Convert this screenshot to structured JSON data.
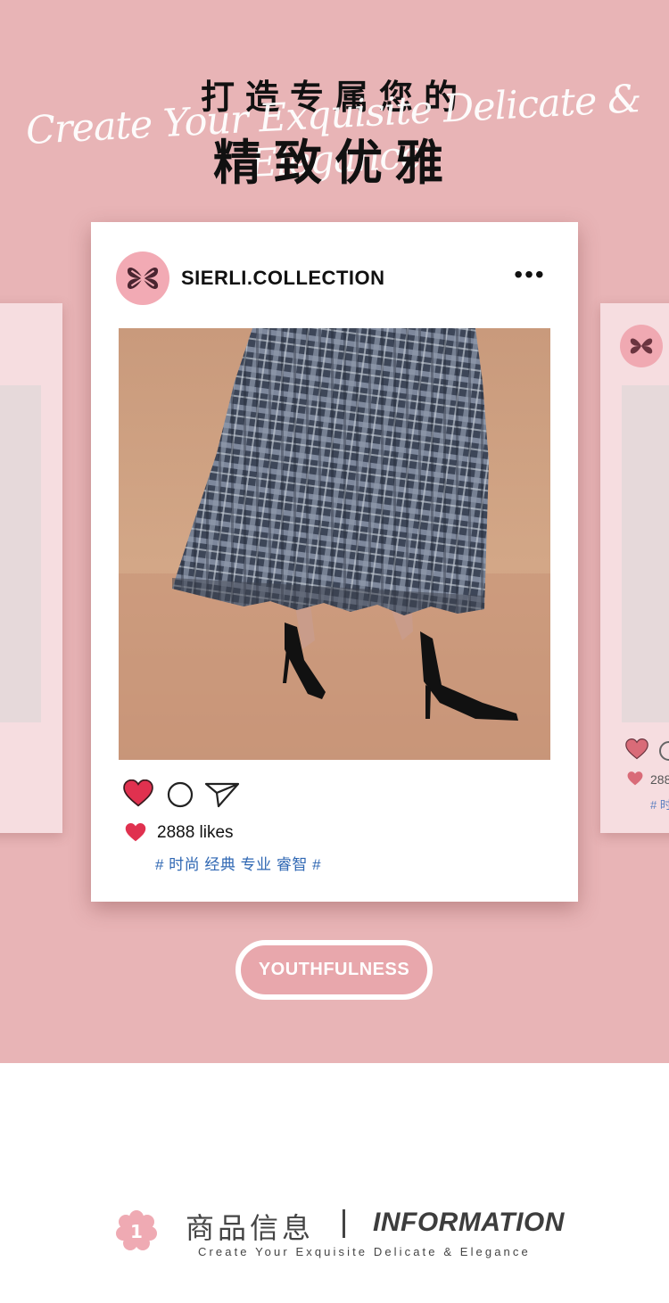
{
  "hero": {
    "headline_top": "打造专属您的",
    "script_line": "Create Your Exquisite Delicate & Elegance",
    "headline_main": "精致优雅"
  },
  "post": {
    "account_name": "SIERLI.COLLECTION",
    "more_label": "•••",
    "avatar_icon": "butterfly-logo-icon",
    "like_icon": "heart-icon",
    "comment_icon": "comment-circle-icon",
    "share_icon": "paper-plane-icon",
    "likes_text": "2888 likes",
    "tags": "# 时尚 经典 专业 睿智 #"
  },
  "side_card_right": {
    "likes_text": "288",
    "tags_text": "# 时"
  },
  "cta": {
    "label": "YOUTHFULNESS"
  },
  "section": {
    "number": "1",
    "title_cn": "商品信息",
    "title_en": "INFORMATION",
    "subtitle": "Create Your Exquisite Delicate & Elegance"
  },
  "colors": {
    "hero_background": "#e8b4b6",
    "heart_red": "#e0314f",
    "tag_blue": "#2f67b3",
    "accent_pink": "#f2aab4"
  }
}
